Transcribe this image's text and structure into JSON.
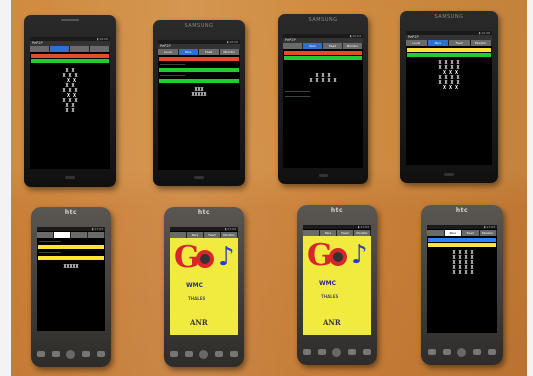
{
  "scene": "eight-phones-on-table",
  "top_row": {
    "phones": [
      {
        "brand": "",
        "app_title": "PeP2P",
        "tabs": [
          "",
          "",
          "",
          ""
        ],
        "grid": "X X\nX X X\n X X\nX X\nX X X\n X X\nX X X\nX X\nX X"
      },
      {
        "brand": "SAMSUNG",
        "app_title": "PeP2P",
        "tabs": [
          "Local",
          "Pers",
          "Feed",
          "Monitor"
        ],
        "grid": "XXX\nXXXXX"
      },
      {
        "brand": "SAMSUNG",
        "app_title": "PeP2P",
        "tabs": [
          "",
          "Pers",
          "Feed",
          "Monitor"
        ],
        "grid": "X X X\nX X X X X"
      },
      {
        "brand": "SAMSUNG",
        "app_title": "PeP2P",
        "tabs": [
          "Local",
          "Pers",
          "Feed",
          "Monitor"
        ],
        "grid": "X X X X\nX X X X\n X X X\nX X X X\nX X X X\n X X X"
      }
    ]
  },
  "bottom_row": {
    "phones": [
      {
        "brand": "htc",
        "grid": "XXXXX"
      },
      {
        "brand": "htc",
        "tabs": [
          "",
          "Pers",
          "Feed",
          "Monitor"
        ],
        "splash": {
          "logo_text": "GOS",
          "partners": [
            "WMC",
            "THALES",
            "ANR"
          ]
        }
      },
      {
        "brand": "htc",
        "tabs": [
          "",
          "Pers",
          "Feed",
          "Monitor"
        ],
        "splash": {
          "logo_text": "GOS",
          "partners": [
            "WMC",
            "THALES",
            "ANR"
          ]
        }
      },
      {
        "brand": "htc",
        "tabs": [
          "",
          "Pers",
          "Feed",
          "Monitor"
        ],
        "grid": "X X X X\nX X X X\nX X X X\nX X X X\nX X X X"
      }
    ]
  },
  "colors": {
    "table": "#c47d34",
    "tab_active": "#2f6fd0",
    "green_bar": "#1fcc33",
    "red_bar": "#e84a2a",
    "yellow_bar": "#ffe23a",
    "splash_bg": "#f1ea3f"
  }
}
